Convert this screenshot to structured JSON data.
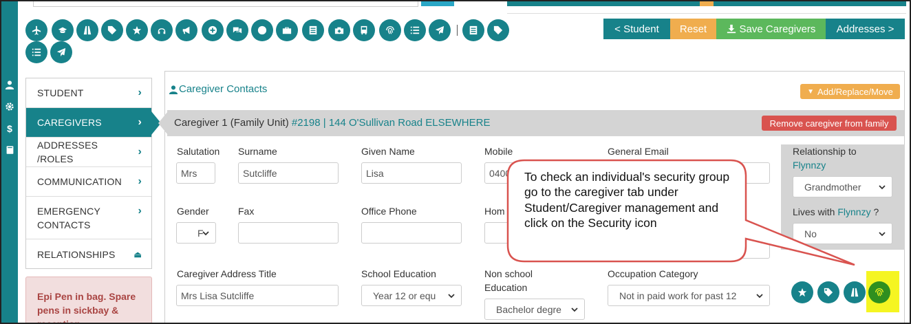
{
  "colors": {
    "teal": "#17828a",
    "orange": "#f0ad4e",
    "green": "#5cb85c",
    "red": "#d9534f",
    "highlight": "#f5f522"
  },
  "rail_icons": [
    "user-icon",
    "gear-icon",
    "dollar-icon",
    "book-icon"
  ],
  "toolbar_icons": [
    "plane-icon",
    "graduation-cap-icon",
    "road-icon",
    "tag-icon",
    "star-icon",
    "headphones-icon",
    "bullhorn-icon",
    "plus-circle-icon",
    "comments-icon",
    "globe-icon",
    "briefcase-icon",
    "list-box-icon",
    "medkit-icon",
    "bus-icon",
    "fingerprint-icon",
    "list-icon",
    "send-icon",
    "list-box-icon",
    "tags-icon",
    "list-icon",
    "send-icon"
  ],
  "actions": {
    "student": "< Student",
    "reset": "Reset",
    "save": "Save Caregivers",
    "addresses": "Addresses >"
  },
  "sidenav": [
    {
      "label": "STUDENT"
    },
    {
      "label": "CAREGIVERS",
      "active": true
    },
    {
      "label": "ADDRESSES /ROLES"
    },
    {
      "label": "COMMUNICATION"
    },
    {
      "label": "EMERGENCY CONTACTS"
    },
    {
      "label": "RELATIONSHIPS"
    }
  ],
  "alert_text": "Epi Pen in bag. Spare pens in sickbay & reception",
  "panel": {
    "title": "Caregiver Contacts",
    "add_replace": "Add/Replace/Move"
  },
  "caregiver": {
    "title": "Caregiver 1 (Family Unit)",
    "link": "#2198 | 144 O'Sullivan Road ELSEWHERE",
    "remove": "Remove caregiver from family"
  },
  "fields": {
    "salutation": {
      "label": "Salutation",
      "value": "Mrs"
    },
    "surname": {
      "label": "Surname",
      "value": "Sutcliffe"
    },
    "given_name": {
      "label": "Given Name",
      "value": "Lisa"
    },
    "mobile": {
      "label": "Mobile",
      "value": "0400"
    },
    "general_email": {
      "label": "General Email",
      "value": ""
    },
    "gender": {
      "label": "Gender",
      "value": "F"
    },
    "fax": {
      "label": "Fax",
      "value": ""
    },
    "office_phone": {
      "label": "Office Phone",
      "value": ""
    },
    "home_phone": {
      "label": "Hom",
      "value": ""
    },
    "address_title": {
      "label": "Caregiver Address Title",
      "value": "Mrs Lisa Sutcliffe"
    },
    "school_education": {
      "label": "School Education",
      "value": "Year 12 or equ"
    },
    "nonschool_education": {
      "label": "Non school Education",
      "value": "Bachelor degre"
    },
    "occupation_category": {
      "label": "Occupation Category",
      "value": "Not in paid work for past 12"
    }
  },
  "relationship": {
    "label": "Relationship to",
    "name": "Flynnzy",
    "value": "Grandmother"
  },
  "lives_with": {
    "label": "Lives with",
    "name": "Flynnzy",
    "suffix": "?",
    "value": "No"
  },
  "bottom_icons": [
    "star-icon",
    "tags-icon",
    "road-icon",
    "fingerprint-icon"
  ],
  "callout": "To check an individual's security group go to the caregiver tab under Student/Caregiver management and click on the Security icon"
}
